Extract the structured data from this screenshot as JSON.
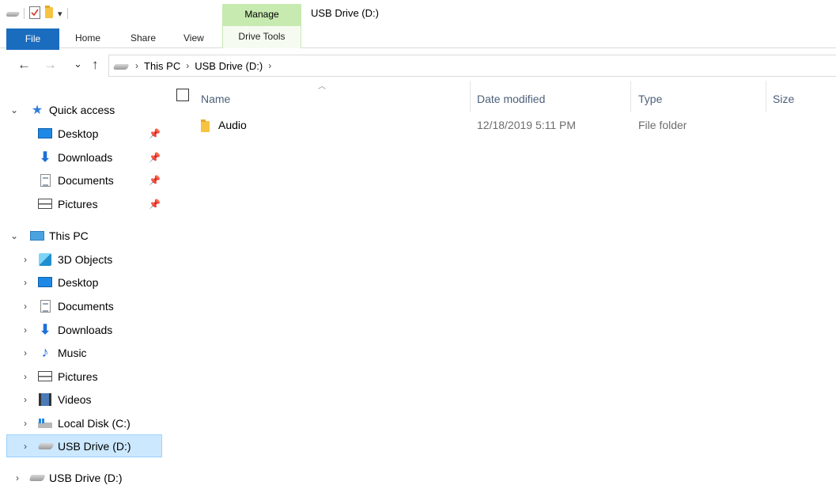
{
  "title_bar": {
    "manage_tab": "Manage",
    "window_title": "USB Drive (D:)",
    "qat_dropdown": "▾"
  },
  "ribbon": {
    "tabs": [
      "File",
      "Home",
      "Share",
      "View",
      "Drive Tools"
    ]
  },
  "address": {
    "back": "←",
    "forward": "→",
    "recent": "⌄",
    "up": "↑",
    "crumbs": [
      "This PC",
      "USB Drive (D:)"
    ],
    "separator": "›"
  },
  "nav_pane": {
    "quick_access": {
      "label": "Quick access",
      "items": [
        {
          "label": "Desktop",
          "icon": "desktop-icon"
        },
        {
          "label": "Downloads",
          "icon": "download-icon"
        },
        {
          "label": "Documents",
          "icon": "documents-icon"
        },
        {
          "label": "Pictures",
          "icon": "pictures-icon"
        }
      ]
    },
    "this_pc": {
      "label": "This PC",
      "items": [
        {
          "label": "3D Objects",
          "icon": "3d-objects-icon"
        },
        {
          "label": "Desktop",
          "icon": "desktop-icon"
        },
        {
          "label": "Documents",
          "icon": "documents-icon"
        },
        {
          "label": "Downloads",
          "icon": "download-icon"
        },
        {
          "label": "Music",
          "icon": "music-icon"
        },
        {
          "label": "Pictures",
          "icon": "pictures-icon"
        },
        {
          "label": "Videos",
          "icon": "videos-icon"
        },
        {
          "label": "Local Disk (C:)",
          "icon": "local-disk-icon"
        },
        {
          "label": "USB Drive (D:)",
          "icon": "usb-drive-icon"
        }
      ]
    },
    "extra_drive": {
      "label": "USB Drive (D:)",
      "icon": "usb-drive-icon"
    }
  },
  "file_list": {
    "columns": [
      "Name",
      "Date modified",
      "Type",
      "Size"
    ],
    "rows": [
      {
        "name": "Audio",
        "date": "12/18/2019 5:11 PM",
        "type": "File folder",
        "size": ""
      }
    ]
  },
  "colors": {
    "file_tab": "#1a6cbf",
    "manage_tab": "#c7eab0",
    "selection": "#cce8ff",
    "header_text": "#4c607a"
  }
}
